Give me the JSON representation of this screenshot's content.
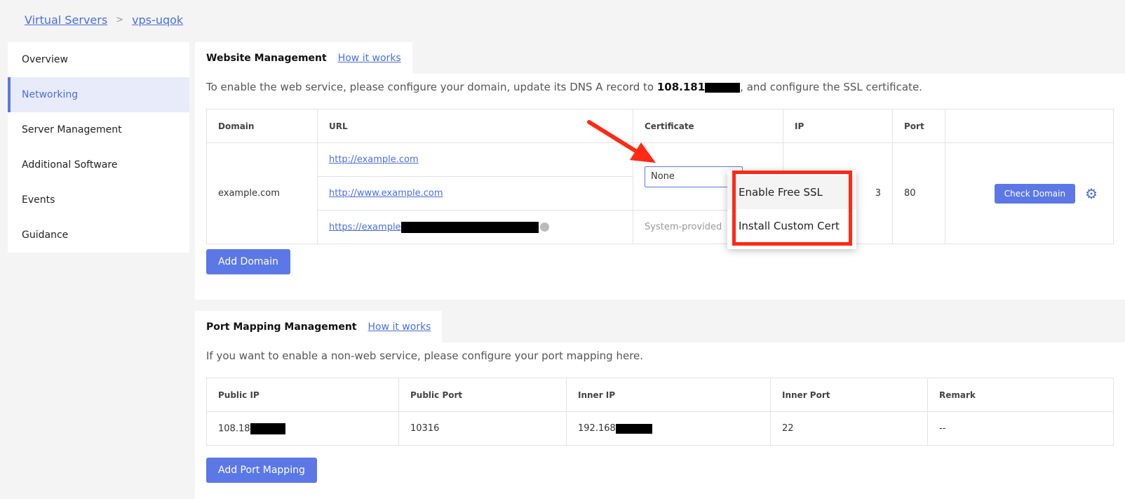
{
  "breadcrumb": {
    "root": "Virtual Servers",
    "separator": ">",
    "current": "vps-uqok"
  },
  "sidebar": {
    "items": [
      {
        "label": "Overview"
      },
      {
        "label": "Networking"
      },
      {
        "label": "Server Management"
      },
      {
        "label": "Additional Software"
      },
      {
        "label": "Events"
      },
      {
        "label": "Guidance"
      }
    ]
  },
  "website": {
    "title": "Website Management",
    "how_link": "How it works",
    "desc_pre": "To enable the web service, please configure your domain, update its DNS A record to ",
    "desc_ip": "108.181",
    "desc_post": ", and configure the SSL certificate.",
    "headers": [
      "Domain",
      "URL",
      "Certificate",
      "IP",
      "Port",
      ""
    ],
    "domain": "example.com",
    "urls": [
      "http://example.com",
      "http://www.example.com",
      "https://example"
    ],
    "cert_value": "None",
    "cert_system": "System-provided",
    "ip_suffix": "3",
    "port": "80",
    "check_button": "Check Domain",
    "add_button": "Add Domain"
  },
  "dropdown": {
    "items": [
      "Enable Free SSL",
      "Install Custom Cert"
    ]
  },
  "ports": {
    "title": "Port Mapping Management",
    "how_link": "How it works",
    "desc": "If you want to enable a non-web service, please configure your port mapping here.",
    "headers": [
      "Public IP",
      "Public Port",
      "Inner IP",
      "Inner Port",
      "Remark"
    ],
    "row": {
      "public_ip": "108.18",
      "public_port": "10316",
      "inner_ip": "192.168",
      "inner_port": "22",
      "remark": "--"
    },
    "add_button": "Add Port Mapping"
  },
  "colors": {
    "accent": "#5b78e6",
    "link": "#4a6ee0",
    "annotation": "#ff2a14"
  },
  "icons": {
    "gear": "gear-icon",
    "info": "info-icon",
    "arrow": "arrow-annotation"
  }
}
